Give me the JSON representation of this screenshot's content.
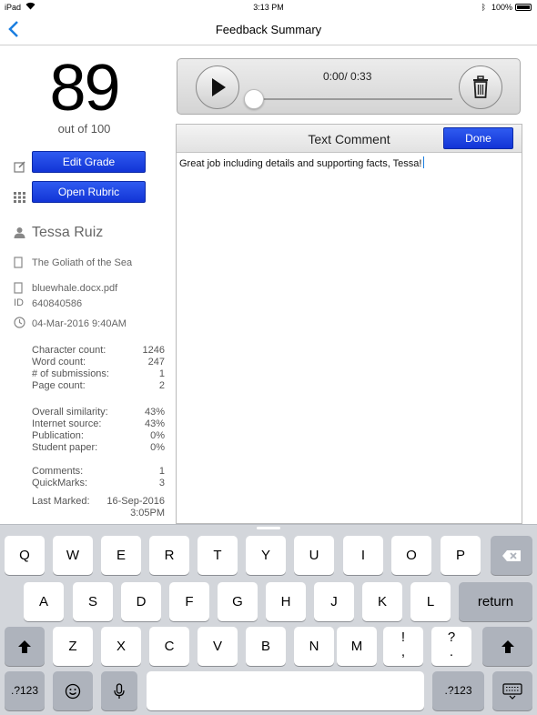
{
  "status": {
    "device": "iPad",
    "time": "3:13 PM",
    "battery": "100%"
  },
  "nav": {
    "title": "Feedback Summary"
  },
  "grade": {
    "score": "89",
    "out_of": "out of 100"
  },
  "buttons": {
    "edit_grade": "Edit Grade",
    "open_rubric": "Open Rubric",
    "done": "Done"
  },
  "student": {
    "name": "Tessa Ruiz",
    "title": "The Goliath of the Sea",
    "file": "bluewhale.docx.pdf",
    "id_label": "ID",
    "id": "640840586",
    "date": "04-Mar-2016 9:40AM"
  },
  "counts": [
    {
      "label": "Character count:",
      "value": "1246"
    },
    {
      "label": "Word count:",
      "value": "247"
    },
    {
      "label": "# of submissions:",
      "value": "1"
    },
    {
      "label": "Page count:",
      "value": "2"
    }
  ],
  "similarity": [
    {
      "label": "Overall similarity:",
      "value": "43%"
    },
    {
      "label": "Internet source:",
      "value": "43%"
    },
    {
      "label": "Publication:",
      "value": "0%"
    },
    {
      "label": "Student paper:",
      "value": "0%"
    }
  ],
  "marks": [
    {
      "label": "Comments:",
      "value": "1"
    },
    {
      "label": "QuickMarks:",
      "value": "3"
    }
  ],
  "last_marked": {
    "label": "Last Marked:",
    "date": "16-Sep-2016",
    "time": "3:05PM"
  },
  "player": {
    "time": "0:00/  0:33"
  },
  "comment": {
    "title": "Text Comment",
    "text": "Great job including details and supporting facts, Tessa!"
  },
  "keyboard": {
    "row1": [
      "Q",
      "W",
      "E",
      "R",
      "T",
      "Y",
      "U",
      "I",
      "O",
      "P"
    ],
    "row2": [
      "A",
      "S",
      "D",
      "F",
      "G",
      "H",
      "J",
      "K",
      "L"
    ],
    "row3": [
      "Z",
      "X",
      "C",
      "V",
      "B",
      "N",
      "M"
    ],
    "punct1": [
      "!",
      ","
    ],
    "punct2": [
      "?",
      "."
    ],
    "return": "return",
    "numbers": ".?123"
  }
}
